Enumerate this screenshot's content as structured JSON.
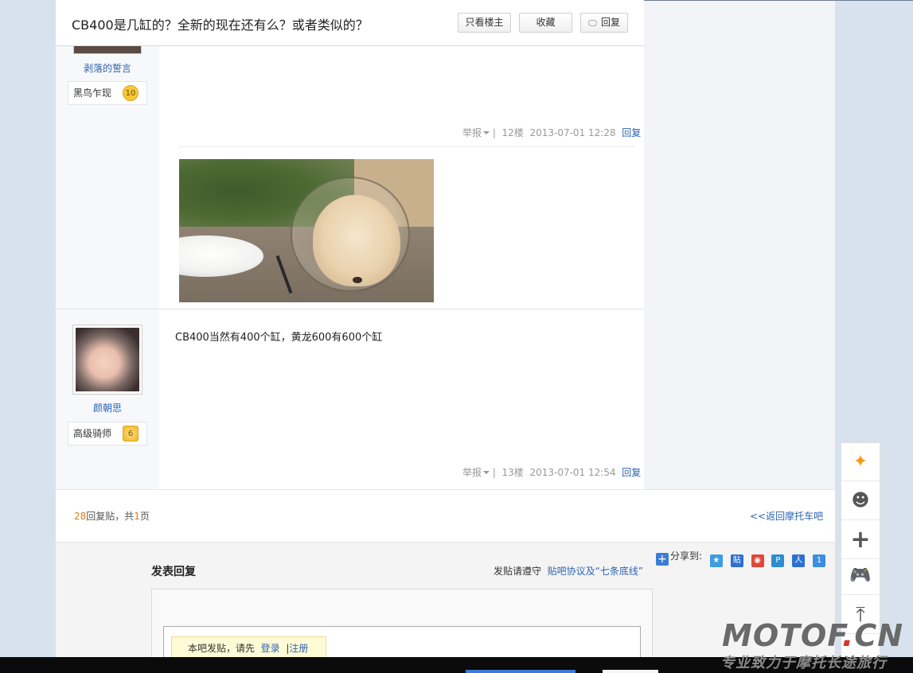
{
  "thread": {
    "title": "CB400是几缸的？全新的现在还有么？或者类似的？",
    "btn_only_owner": "只看楼主",
    "btn_favorite": "收藏",
    "btn_reply": "回复"
  },
  "posts": [
    {
      "username": "剥落的誓言",
      "badge_title": "黑鸟乍现",
      "badge_level": "10",
      "report": "举报",
      "floor": "12楼",
      "time": "2013-07-01 12:28",
      "reply": "回复"
    },
    {
      "username": "颜朝思",
      "badge_title": "高级骑师",
      "badge_level": "6",
      "content": "CB400当然有400个缸，黄龙600有600个缸",
      "report": "举报",
      "floor": "13楼",
      "time": "2013-07-01 12:54",
      "reply": "回复"
    }
  ],
  "pager": {
    "reply_count": "28",
    "reply_label": "回复贴，共",
    "page_count": "1",
    "page_label": "页",
    "back_link": "<<返回摩托车吧"
  },
  "reply_form": {
    "title": "发表回复",
    "rule_prefix": "发贴请遵守",
    "rule_link": "贴吧协议及“七条底线”",
    "share_label": "分享到:",
    "login_prefix": "本吧发贴，请先",
    "login_link": "登录",
    "register_link": "注册"
  },
  "watermark": {
    "logo_main": "MOTOF",
    "logo_dot": ".",
    "logo_tld": "CN",
    "slogan": "专业致力于摩托长途旅行"
  },
  "separators": {
    "pipe": "|"
  },
  "colors": {
    "link": "#2d64b3",
    "accent_orange": "#e47911",
    "page_bg": "#d7e2ee"
  }
}
